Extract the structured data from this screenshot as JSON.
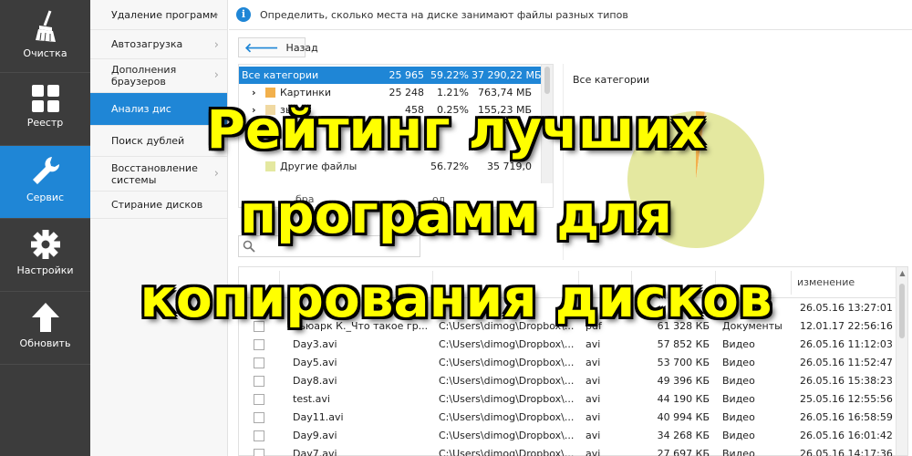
{
  "nav": {
    "items": [
      {
        "label": "Очистка",
        "icon": "broom-icon"
      },
      {
        "label": "Реестр",
        "icon": "grid-icon"
      },
      {
        "label": "Сервис",
        "icon": "wrench-icon"
      },
      {
        "label": "Настройки",
        "icon": "gear-icon"
      },
      {
        "label": "Обновить",
        "icon": "arrow-up-icon"
      }
    ],
    "active": "Сервис"
  },
  "submenu": {
    "items": [
      "Удаление программ",
      "Автозагрузка",
      "Дополнения браузеров",
      "Анализ дис",
      "Поиск дублей",
      "Восстановление системы",
      "Стирание дисков"
    ],
    "active": "Анализ дис"
  },
  "info": {
    "text": "Определить, сколько места на диске занимают файлы разных типов"
  },
  "back_label": "Назад",
  "categories": [
    {
      "name": "Все категории",
      "count": "25 965",
      "pct": "59.22%",
      "size": "37 290,22 МБ"
    },
    {
      "toggle": "›",
      "name": "Картинки",
      "count": "25 248",
      "pct": "1.21%",
      "size": "763,74 МБ"
    },
    {
      "toggle": "›",
      "name": "зыка",
      "count": "458",
      "pct": "0.25%",
      "size": "155,23 МБ"
    },
    {
      "name": "Другие файлы",
      "pct": "56.72%",
      "size": "35 719,0"
    }
  ],
  "category_summary": [
    "бра",
    "ол"
  ],
  "chart_data": {
    "type": "pie",
    "title": "Все категории",
    "categories": [
      "Другие файлы",
      "Картинки",
      "зыка"
    ],
    "values": [
      56.72,
      1.21,
      0.25
    ],
    "colors": [
      "#e4e8a0",
      "#f2b04c",
      "#f0d9a2"
    ]
  },
  "files": {
    "header": {
      "changed": "изменение"
    },
    "rows": [
      {
        "name": "",
        "path": "",
        "ext": "",
        "size": "",
        "type": "",
        "date": "26.05.16 13:27:01"
      },
      {
        "name": "Вьюарк К._Что такое гр...",
        "path": "C:\\Users\\dimog\\Dropbox\\...",
        "ext": "pdf",
        "size": "61 328 КБ",
        "type": "Документы",
        "date": "12.01.17 22:56:16"
      },
      {
        "name": "Day3.avi",
        "path": "C:\\Users\\dimog\\Dropbox\\...",
        "ext": "avi",
        "size": "57 852 КБ",
        "type": "Видео",
        "date": "26.05.16 11:12:03"
      },
      {
        "name": "Day5.avi",
        "path": "C:\\Users\\dimog\\Dropbox\\...",
        "ext": "avi",
        "size": "53 700 КБ",
        "type": "Видео",
        "date": "26.05.16 11:52:47"
      },
      {
        "name": "Day8.avi",
        "path": "C:\\Users\\dimog\\Dropbox\\...",
        "ext": "avi",
        "size": "49 396 КБ",
        "type": "Видео",
        "date": "26.05.16 15:38:23"
      },
      {
        "name": "test.avi",
        "path": "C:\\Users\\dimog\\Dropbox\\...",
        "ext": "avi",
        "size": "44 190 КБ",
        "type": "Видео",
        "date": "25.05.16 12:55:56"
      },
      {
        "name": "Day11.avi",
        "path": "C:\\Users\\dimog\\Dropbox\\...",
        "ext": "avi",
        "size": "40 994 КБ",
        "type": "Видео",
        "date": "26.05.16 16:58:59"
      },
      {
        "name": "Day9.avi",
        "path": "C:\\Users\\dimog\\Dropbox\\...",
        "ext": "avi",
        "size": "34 268 КБ",
        "type": "Видео",
        "date": "26.05.16 16:01:42"
      },
      {
        "name": "Day7.avi",
        "path": "C:\\Users\\dimog\\Dropbox\\...",
        "ext": "avi",
        "size": "27 697 КБ",
        "type": "Видео",
        "date": "26.05.16 14:17:36"
      }
    ]
  },
  "overlay": {
    "lines": [
      "Рейтинг лучших",
      "программ для",
      "копирования дисков"
    ],
    "color": "#ffff00"
  },
  "colors": {
    "accent": "#1f86d6",
    "nav_bg": "#3c3c3c"
  }
}
